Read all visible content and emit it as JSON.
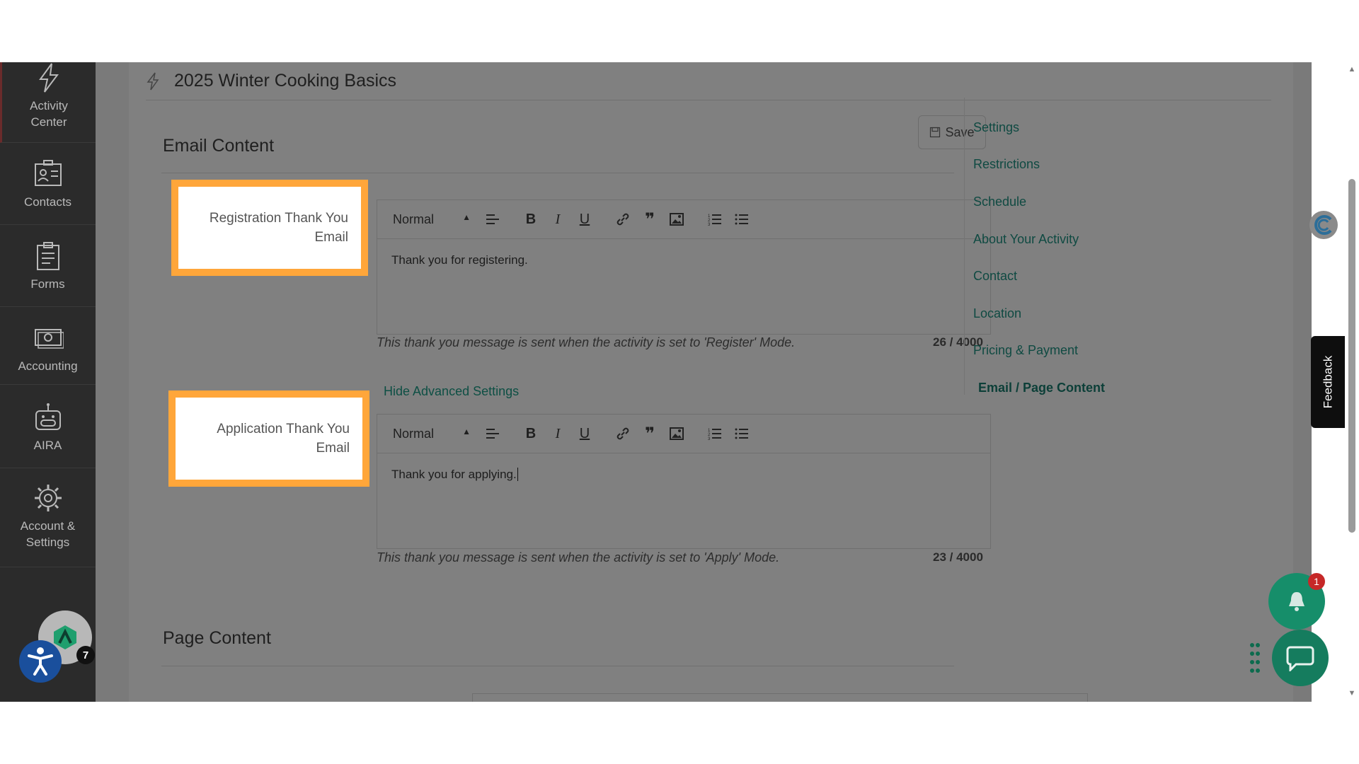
{
  "sidebar": {
    "items": [
      {
        "label_1": "Activity",
        "label_2": "Center",
        "icon": "bolt-icon"
      },
      {
        "label": "Contacts",
        "icon": "contacts-icon"
      },
      {
        "label": "Forms",
        "icon": "forms-icon"
      },
      {
        "label": "Accounting",
        "icon": "money-icon"
      },
      {
        "label": "AIRA",
        "icon": "robot-icon"
      },
      {
        "label_1": "Account &",
        "label_2": "Settings",
        "icon": "gear-icon"
      }
    ],
    "avatar_badge": "7"
  },
  "header": {
    "title": "2025 Winter Cooking Basics"
  },
  "email_content": {
    "title": "Email Content",
    "save_label": "Save",
    "registration": {
      "label_1": "Registration Thank You",
      "label_2": "Email",
      "format": "Normal",
      "body": "Thank you for registering.",
      "hint": "This thank you message is sent when the activity is set to 'Register' Mode.",
      "count": "26 / 4000"
    },
    "advanced_link": "Hide Advanced Settings",
    "application": {
      "label_1": "Application Thank You",
      "label_2": "Email",
      "format": "Normal",
      "body": "Thank you for applying.",
      "hint": "This thank you message is sent when the activity is set to 'Apply' Mode.",
      "count": "23 / 4000"
    }
  },
  "page_content": {
    "title": "Page Content"
  },
  "right_nav": {
    "items": [
      "Settings",
      "Restrictions",
      "Schedule",
      "About Your Activity",
      "Contact",
      "Location",
      "Pricing & Payment",
      "Email / Page Content"
    ],
    "active": "Email / Page Content"
  },
  "feedback_label": "Feedback",
  "notifications": {
    "count": "1"
  },
  "colors": {
    "highlight": "#ffa63a",
    "link": "#0f4a42",
    "sidebar": "#2b2b2b",
    "fab": "#168e6a"
  }
}
